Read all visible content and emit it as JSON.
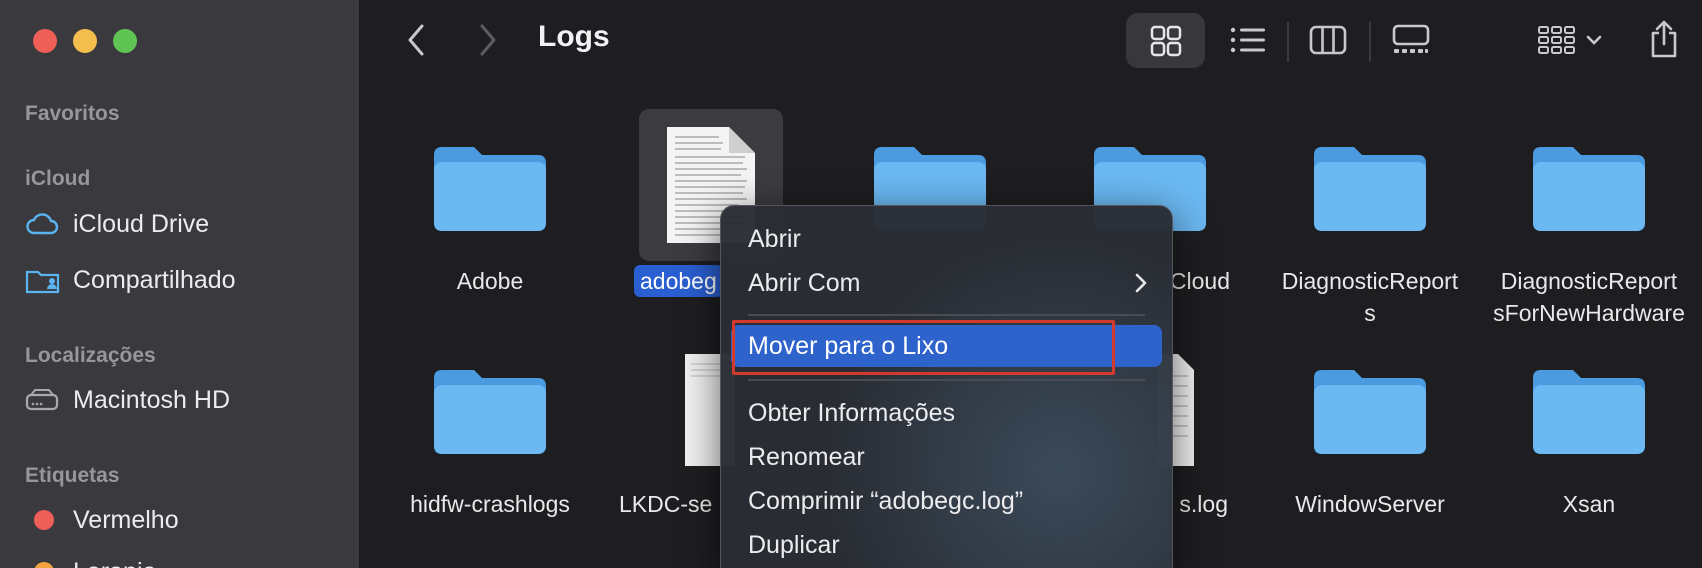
{
  "window": {
    "title": "Logs"
  },
  "sidebar": {
    "sections": [
      {
        "title": "Favoritos"
      },
      {
        "title": "iCloud"
      },
      {
        "title": "Localizações"
      },
      {
        "title": "Etiquetas"
      }
    ],
    "icloud_items": [
      {
        "label": "iCloud Drive",
        "icon": "cloud-icon"
      },
      {
        "label": "Compartilhado",
        "icon": "shared-folder-icon"
      }
    ],
    "locations": [
      {
        "label": "Macintosh HD",
        "icon": "disk-icon"
      }
    ],
    "tags": [
      {
        "label": "Vermelho",
        "color": "#ee5f57"
      },
      {
        "label": "Laranja",
        "color": "#f4a340"
      }
    ]
  },
  "toolbar": {
    "back_icon": "chevron-left-icon",
    "forward_icon": "chevron-right-icon",
    "views": [
      "icons-view",
      "list-view",
      "columns-view",
      "gallery-view"
    ],
    "group_icon": "group-by-icon",
    "share_icon": "share-icon"
  },
  "files": [
    {
      "name": "Adobe",
      "type": "folder"
    },
    {
      "name": "adobegc.log",
      "visible_label": "adobeg",
      "type": "document",
      "selected": true
    },
    {
      "name": "",
      "type": "folder"
    },
    {
      "name": "Cloud",
      "type": "folder"
    },
    {
      "name": "DiagnosticReport",
      "name_line2": "s",
      "type": "folder"
    },
    {
      "name": "DiagnosticReport",
      "name_line2": "sForNewHardware",
      "type": "folder"
    },
    {
      "name": "hidfw-crashlogs",
      "type": "folder"
    },
    {
      "name": "LKDC-se",
      "type": "document"
    },
    {
      "name": "",
      "type": "folder"
    },
    {
      "name": "s.log",
      "type": "document"
    },
    {
      "name": "WindowServer",
      "type": "folder"
    },
    {
      "name": "Xsan",
      "type": "folder"
    }
  ],
  "context_menu": {
    "items": [
      {
        "label": "Abrir"
      },
      {
        "label": "Abrir Com",
        "has_submenu": true
      },
      {
        "label": "Mover para o Lixo",
        "highlighted": true
      },
      {
        "label": "Obter Informações"
      },
      {
        "label": "Renomear"
      },
      {
        "label": "Comprimir “adobegc.log”"
      },
      {
        "label": "Duplicar"
      }
    ]
  },
  "colors": {
    "accent": "#2f63cc",
    "folder": "#6bb8f2",
    "highlight_box": "#d23a2e"
  }
}
